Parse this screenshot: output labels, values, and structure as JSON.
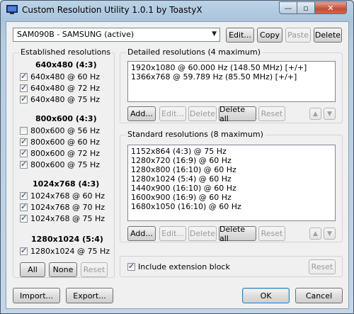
{
  "window": {
    "title": "Custom Resolution Utility 1.0.1 by ToastyX",
    "minimize_glyph": "—",
    "maximize_glyph": "▫",
    "close_glyph": "✕"
  },
  "monitor": {
    "selected": "SAM090B - SAMSUNG (active)",
    "buttons": {
      "edit": "Edit...",
      "copy": "Copy",
      "paste": "Paste",
      "delete": "Delete"
    }
  },
  "established": {
    "label": "Established resolutions",
    "groups": [
      {
        "heading": "640x480 (4:3)",
        "items": [
          {
            "label": "640x480 @ 60 Hz",
            "checked": true
          },
          {
            "label": "640x480 @ 72 Hz",
            "checked": true
          },
          {
            "label": "640x480 @ 75 Hz",
            "checked": true
          }
        ]
      },
      {
        "heading": "800x600 (4:3)",
        "items": [
          {
            "label": "800x600 @ 56 Hz",
            "checked": false
          },
          {
            "label": "800x600 @ 60 Hz",
            "checked": true
          },
          {
            "label": "800x600 @ 72 Hz",
            "checked": true
          },
          {
            "label": "800x600 @ 75 Hz",
            "checked": true
          }
        ]
      },
      {
        "heading": "1024x768 (4:3)",
        "items": [
          {
            "label": "1024x768 @ 60 Hz",
            "checked": true
          },
          {
            "label": "1024x768 @ 70 Hz",
            "checked": true
          },
          {
            "label": "1024x768 @ 75 Hz",
            "checked": true
          }
        ]
      },
      {
        "heading": "1280x1024 (5:4)",
        "items": [
          {
            "label": "1280x1024 @ 75 Hz",
            "checked": true
          }
        ]
      }
    ],
    "buttons": {
      "all": "All",
      "none": "None",
      "reset": "Reset"
    }
  },
  "detailed": {
    "label": "Detailed resolutions (4 maximum)",
    "items": [
      "1920x1080 @ 60.000 Hz (148.50 MHz) [+/+]",
      "1366x768 @ 59.789 Hz (85.50 MHz) [+/+]"
    ],
    "buttons": {
      "add": "Add...",
      "edit": "Edit...",
      "delete": "Delete",
      "delete_all": "Delete all",
      "reset": "Reset"
    }
  },
  "standard": {
    "label": "Standard resolutions (8 maximum)",
    "items": [
      "1152x864 (4:3) @ 75 Hz",
      "1280x720 (16:9) @ 60 Hz",
      "1280x800 (16:10) @ 60 Hz",
      "1280x1024 (5:4) @ 60 Hz",
      "1440x900 (16:10) @ 60 Hz",
      "1600x900 (16:9) @ 60 Hz",
      "1680x1050 (16:10) @ 60 Hz"
    ],
    "buttons": {
      "add": "Add...",
      "edit": "Edit...",
      "delete": "Delete",
      "delete_all": "Delete all",
      "reset": "Reset"
    }
  },
  "extension": {
    "label": "Include extension block",
    "checked": true,
    "reset": "Reset"
  },
  "footer": {
    "import": "Import...",
    "export": "Export...",
    "ok": "OK",
    "cancel": "Cancel"
  },
  "icons": {
    "up": "up-arrow-icon",
    "down": "down-arrow-icon",
    "app": "monitor-icon",
    "dropdown": "chevron-down-icon"
  }
}
